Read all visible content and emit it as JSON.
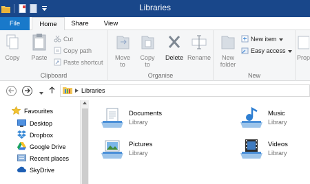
{
  "window": {
    "title": "Libraries"
  },
  "quick_access": {
    "icons": [
      "folder-icon",
      "properties-icon",
      "new-folder-icon",
      "customize-dropdown-icon"
    ]
  },
  "ribbon_tabs": [
    {
      "label": "File"
    },
    {
      "label": "Home"
    },
    {
      "label": "Share"
    },
    {
      "label": "View"
    }
  ],
  "clipboard": {
    "copy": "Copy",
    "paste": "Paste",
    "cut": "Cut",
    "copy_path": "Copy path",
    "paste_shortcut": "Paste shortcut",
    "group_label": "Clipboard"
  },
  "organise": {
    "move_to": "Move to",
    "copy_to": "Copy to",
    "delete": "Delete",
    "rename": "Rename",
    "group_label": "Organise"
  },
  "new_group": {
    "new_folder": "New folder",
    "new_item": "New item",
    "easy_access": "Easy access",
    "group_label": "New"
  },
  "open_group": {
    "properties_partial": "Prop"
  },
  "address": {
    "crumbs": [
      "Libraries"
    ]
  },
  "nav_pane": {
    "favourites_label": "Favourites",
    "items": [
      {
        "label": "Desktop"
      },
      {
        "label": "Dropbox"
      },
      {
        "label": "Google Drive"
      },
      {
        "label": "Recent places"
      },
      {
        "label": "SkyDrive"
      }
    ]
  },
  "libraries": [
    {
      "name": "Documents",
      "kind": "Library"
    },
    {
      "name": "Music",
      "kind": "Library"
    },
    {
      "name": "Pictures",
      "kind": "Library"
    },
    {
      "name": "Videos",
      "kind": "Library"
    }
  ],
  "colors": {
    "titlebar": "#19478a",
    "file_tab": "#1979ca",
    "ribbon_bg": "#f5f6f7",
    "accent_blue": "#2b7bd1"
  }
}
